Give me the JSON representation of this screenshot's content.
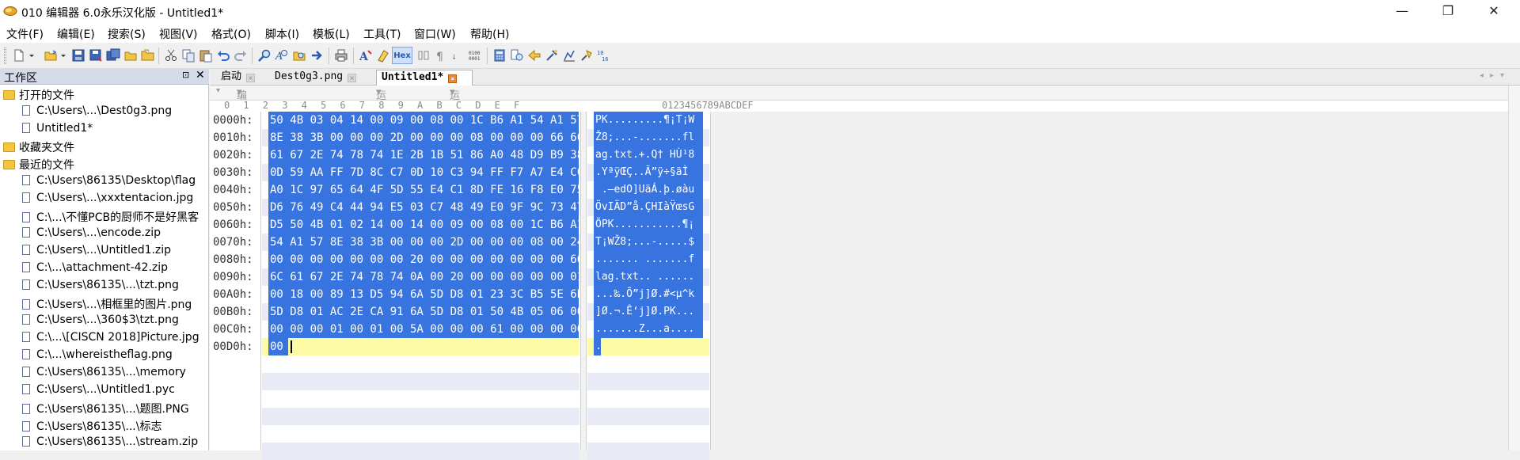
{
  "window": {
    "title": "010 编辑器 6.0永乐汉化版 - Untitled1*",
    "min": "—",
    "max": "❐",
    "close": "✕"
  },
  "menu": [
    "文件(F)",
    "编辑(E)",
    "搜索(S)",
    "视图(V)",
    "格式(O)",
    "脚本(I)",
    "模板(L)",
    "工具(T)",
    "窗口(W)",
    "帮助(H)"
  ],
  "toolbar": {
    "hex_label": "Hex",
    "icons": [
      "new-file-icon",
      "open-file-icon",
      "save-icon",
      "save-as-icon",
      "save-all-icon",
      "close-icon",
      "close-all-icon",
      "cut-icon",
      "copy-icon",
      "paste-icon",
      "undo-icon",
      "redo-icon",
      "find-icon",
      "find-replace-icon",
      "find-in-files-icon",
      "goto-icon",
      "print-icon",
      "font-icon",
      "highlight-icon",
      "hex-mode-icon",
      "columns-icon",
      "pilcrow-icon",
      "binary-icon",
      "calculator-icon",
      "compare-icon",
      "checksum-icon",
      "tools-icon",
      "histogram-icon",
      "conversion-icon",
      "base-converter-icon"
    ]
  },
  "workspace": {
    "title": "工作区",
    "pin": "⊡",
    "close": "✕",
    "sections": [
      {
        "label": "打开的文件",
        "items": [
          "C:\\Users\\...\\Dest0g3.png",
          "Untitled1*"
        ]
      },
      {
        "label": "收藏夹文件",
        "items": []
      },
      {
        "label": "最近的文件",
        "items": [
          "C:\\Users\\86135\\Desktop\\flag",
          "C:\\Users\\...\\xxxtentacion.jpg",
          "C:\\...\\不懂PCB的厨师不是好黑客",
          "C:\\Users\\...\\encode.zip",
          "C:\\Users\\...\\Untitled1.zip",
          "C:\\...\\attachment-42.zip",
          "C:\\Users\\86135\\...\\tzt.png",
          "C:\\Users\\...\\相框里的图片.png",
          "C:\\Users\\...\\360$3\\tzt.png",
          "C:\\...\\[CISCN 2018]Picture.jpg",
          "C:\\...\\whereistheflag.png",
          "C:\\Users\\86135\\...\\memory",
          "C:\\Users\\...\\Untitled1.pyc",
          "C:\\Users\\86135\\...\\题图.PNG",
          "C:\\Users\\86135\\...\\标志",
          "C:\\Users\\86135\\...\\stream.zip"
        ]
      }
    ]
  },
  "tabs": [
    {
      "label": "启动",
      "active": false
    },
    {
      "label": "Dest0g3.png",
      "active": false
    },
    {
      "label": "Untitled1*",
      "active": true
    }
  ],
  "infobar": {
    "edit_as": "编辑为: 十六进制(H)",
    "run_script": "运行脚本",
    "run_template": "运行模板"
  },
  "hex_header": [
    "0",
    "1",
    "2",
    "3",
    "4",
    "5",
    "6",
    "7",
    "8",
    "9",
    "A",
    "B",
    "C",
    "D",
    "E",
    "F"
  ],
  "ascii_header": "0123456789ABCDEF",
  "hex_rows": [
    {
      "addr": "0000h:",
      "hex": "50 4B 03 04 14 00 09 00 08 00 1C B6 A1 54 A1 57",
      "ascii": "PK.........¶¡T¡W"
    },
    {
      "addr": "0010h:",
      "hex": "8E 38 3B 00 00 00 2D 00 00 00 08 00 00 00 66 6C",
      "ascii": "Ž8;...-.......fl"
    },
    {
      "addr": "0020h:",
      "hex": "61 67 2E 74 78 74 1E 2B 1B 51 86 A0 48 D9 B9 38",
      "ascii": "ag.txt.+.Q† HÙ¹8"
    },
    {
      "addr": "0030h:",
      "hex": "0D 59 AA FF 7D 8C C7 0D 10 C3 94 FF F7 A7 E4 CC",
      "ascii": ".YªÿŒÇ..Ã”ÿ÷§äÌ"
    },
    {
      "addr": "0040h:",
      "hex": "A0 1C 97 65 64 4F 5D 55 E4 C1 8D FE 16 F8 E0 75",
      "ascii": " .—edO]UäÁ.þ.øàu"
    },
    {
      "addr": "0050h:",
      "hex": "D6 76 49 C4 44 94 E5 03 C7 48 49 E0 9F 9C 73 47",
      "ascii": "ÖvIÄD”å.ÇHIàŸœsG"
    },
    {
      "addr": "0060h:",
      "hex": "D5 50 4B 01 02 14 00 14 00 09 00 08 00 1C B6 A1",
      "ascii": "ÕPK...........¶¡"
    },
    {
      "addr": "0070h:",
      "hex": "54 A1 57 8E 38 3B 00 00 00 2D 00 00 00 08 00 24",
      "ascii": "T¡WŽ8;...-.....$"
    },
    {
      "addr": "0080h:",
      "hex": "00 00 00 00 00 00 00 20 00 00 00 00 00 00 00 66",
      "ascii": "....... .......f"
    },
    {
      "addr": "0090h:",
      "hex": "6C 61 67 2E 74 78 74 0A 00 20 00 00 00 00 00 01",
      "ascii": "lag.txt.. ......"
    },
    {
      "addr": "00A0h:",
      "hex": "00 18 00 89 13 D5 94 6A 5D D8 01 23 3C B5 5E 6B",
      "ascii": "...‰.Õ”j]Ø.#<µ^k"
    },
    {
      "addr": "00B0h:",
      "hex": "5D D8 01 AC 2E CA 91 6A 5D D8 01 50 4B 05 06 00",
      "ascii": "]Ø.¬.Ê‘j]Ø.PK..."
    },
    {
      "addr": "00C0h:",
      "hex": "00 00 00 01 00 01 00 5A 00 00 00 61 00 00 00 00",
      "ascii": ".......Z...a...."
    },
    {
      "addr": "00D0h:",
      "hex": "00",
      "ascii": "."
    }
  ],
  "colors": {
    "selection": "#3874e0",
    "stripe": "#e8eaf5",
    "current_line": "#fdfca5"
  }
}
